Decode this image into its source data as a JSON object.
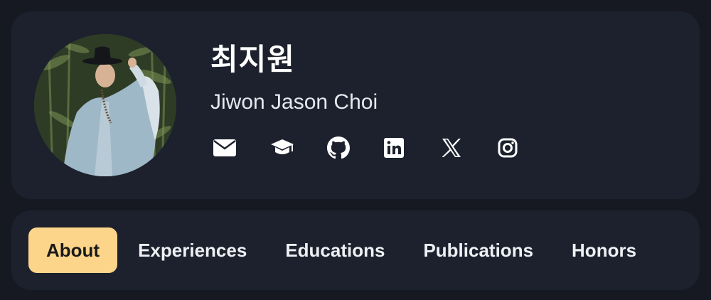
{
  "profile": {
    "name_korean": "최지원",
    "name_english": "Jiwon Jason Choi",
    "avatar_description": "profile-photo",
    "socials": [
      {
        "icon": "envelope-icon",
        "name": "email-link"
      },
      {
        "icon": "graduation-cap-icon",
        "name": "scholar-link"
      },
      {
        "icon": "github-icon",
        "name": "github-link"
      },
      {
        "icon": "linkedin-icon",
        "name": "linkedin-link"
      },
      {
        "icon": "x-icon",
        "name": "x-link"
      },
      {
        "icon": "instagram-icon",
        "name": "instagram-link"
      }
    ]
  },
  "tabs": [
    {
      "label": "About",
      "active": true
    },
    {
      "label": "Experiences",
      "active": false
    },
    {
      "label": "Educations",
      "active": false
    },
    {
      "label": "Publications",
      "active": false
    },
    {
      "label": "Honors",
      "active": false
    }
  ],
  "colors": {
    "background": "#161922",
    "card": "#1c212d",
    "accent": "#fcd58b",
    "text": "#ffffff"
  }
}
